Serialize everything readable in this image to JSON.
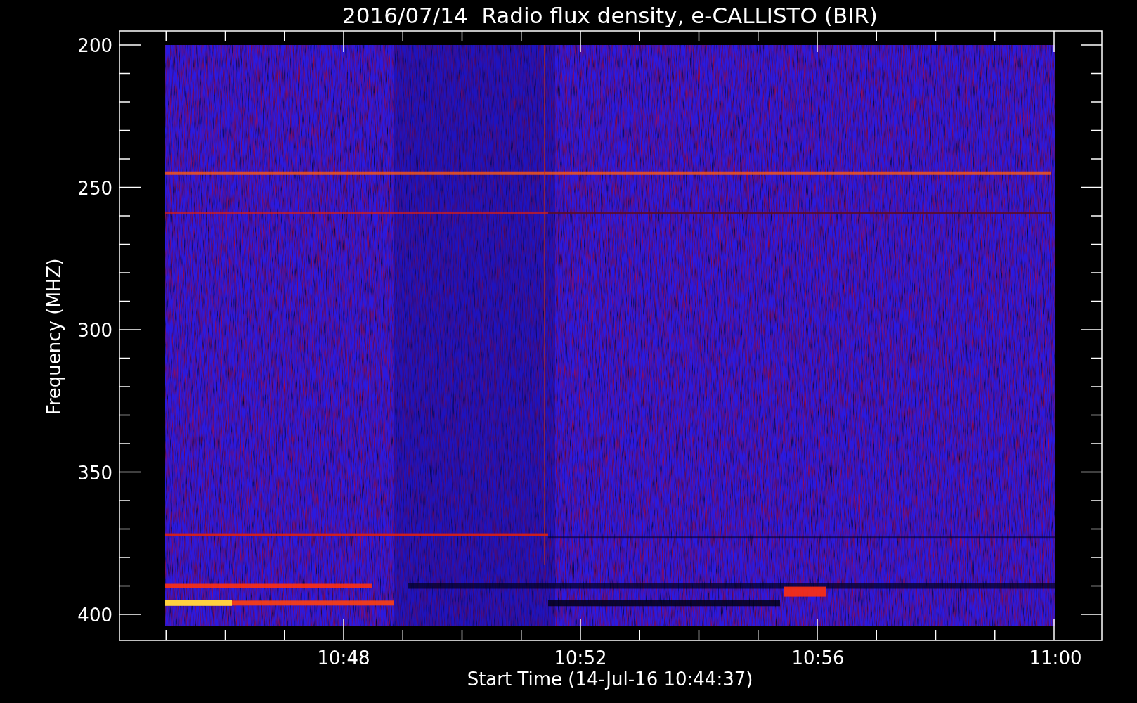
{
  "plot": {
    "title": "2016/07/14  Radio flux density, e-CALLISTO (BIR)",
    "ylabel": "Frequency (MHZ)",
    "xlabel": "Start Time (14-Jul-16 10:44:37)",
    "yticks": [
      "200",
      "250",
      "300",
      "350",
      "400"
    ],
    "xticks": [
      "10:48",
      "10:52",
      "10:56",
      "11:00"
    ]
  }
}
